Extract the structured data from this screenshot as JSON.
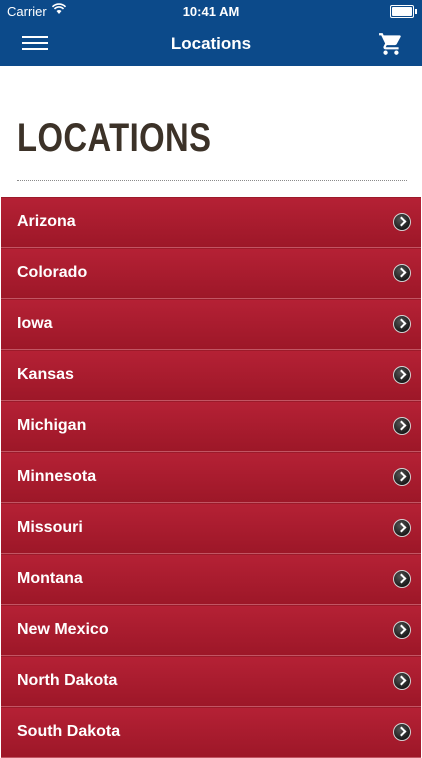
{
  "status": {
    "carrier": "Carrier",
    "time": "10:41 AM"
  },
  "nav": {
    "title": "Locations",
    "menu_icon": "hamburger-menu-icon",
    "cart_icon": "shopping-cart-icon"
  },
  "page": {
    "heading": "LOCATIONS"
  },
  "locations": [
    {
      "label": "Arizona"
    },
    {
      "label": "Colorado"
    },
    {
      "label": "Iowa"
    },
    {
      "label": "Kansas"
    },
    {
      "label": "Michigan"
    },
    {
      "label": "Minnesota"
    },
    {
      "label": "Missouri"
    },
    {
      "label": "Montana"
    },
    {
      "label": "New Mexico"
    },
    {
      "label": "North Dakota"
    },
    {
      "label": "South Dakota"
    }
  ],
  "colors": {
    "header": "#0c4a8a",
    "row": "#a81c2f",
    "title": "#3c3228"
  }
}
